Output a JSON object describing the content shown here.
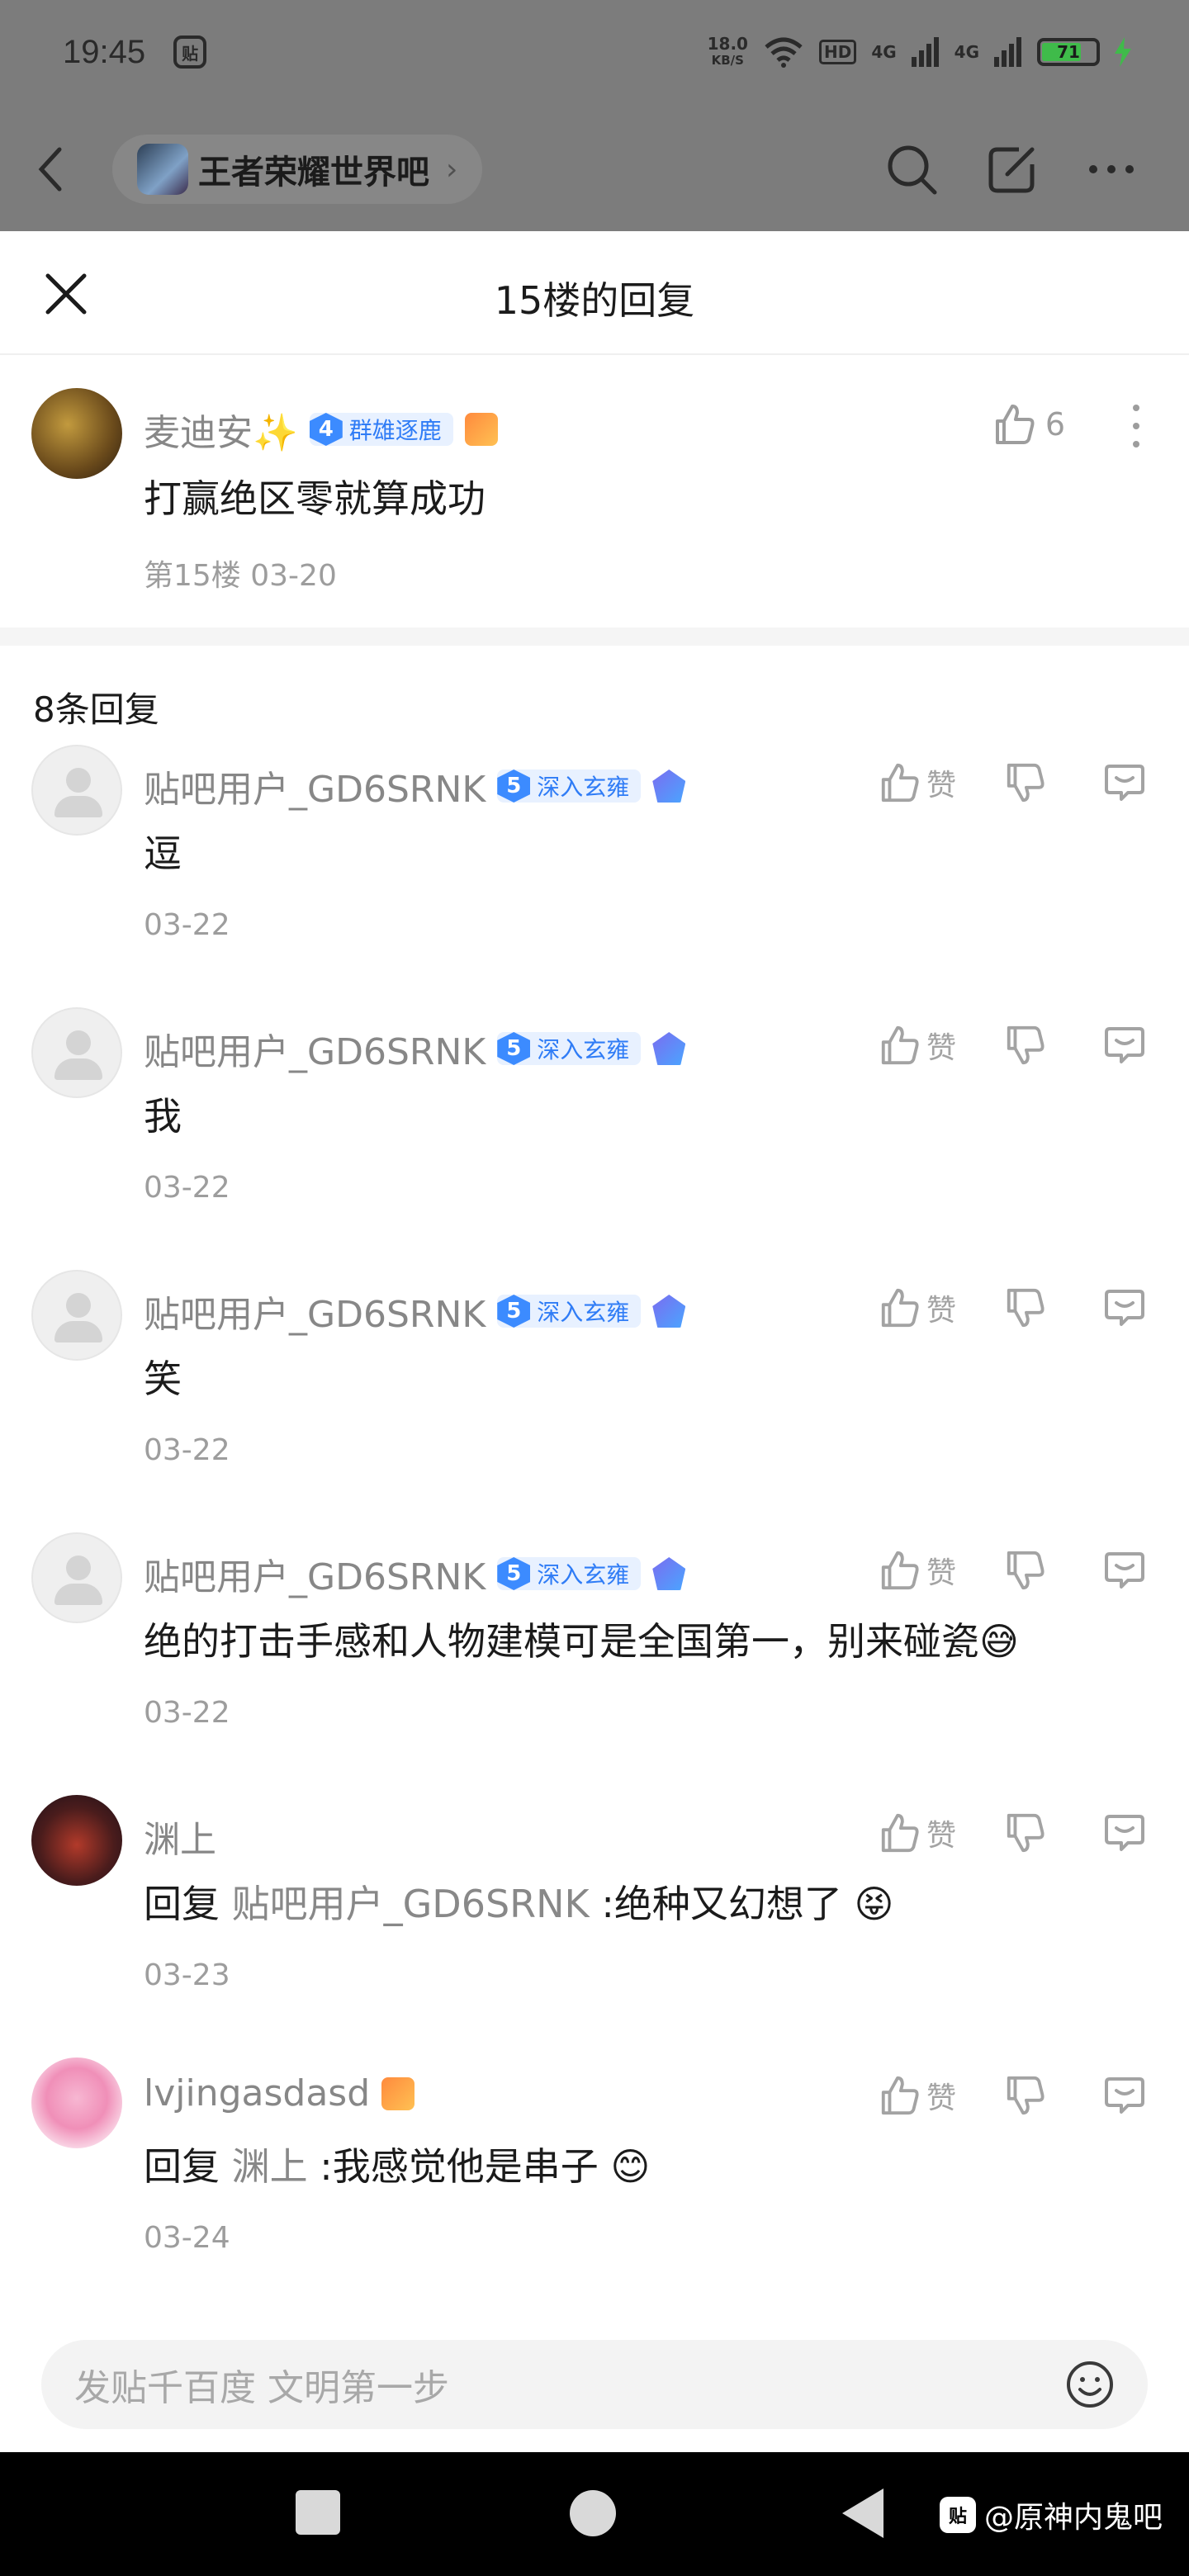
{
  "status_bar": {
    "time": "19:45",
    "app_icon": "贴",
    "net_speed_value": "18.0",
    "net_speed_unit": "KB/S",
    "hd_label": "HD",
    "signal_1": "4G",
    "signal_2": "4G",
    "battery": "71",
    "battery_level": 0.71
  },
  "topnav": {
    "forum_name": "王者荣耀世界吧"
  },
  "sheet": {
    "title": "15楼的回复",
    "main_post": {
      "username": "麦迪安✨",
      "badge_level": "4",
      "badge_text": "群雄逐鹿",
      "content": "打赢绝区零就算成功",
      "meta": "第15楼 03-20",
      "likes": "6"
    },
    "reply_count": "8条回复",
    "like_label": "赞",
    "replies": [
      {
        "username": "贴吧用户_GD6SRNK",
        "badge_level": "5",
        "badge_text": "深入玄雍",
        "content": "逗",
        "date": "03-22"
      },
      {
        "username": "贴吧用户_GD6SRNK",
        "badge_level": "5",
        "badge_text": "深入玄雍",
        "content": "我",
        "date": "03-22"
      },
      {
        "username": "贴吧用户_GD6SRNK",
        "badge_level": "5",
        "badge_text": "深入玄雍",
        "content": "笑",
        "date": "03-22"
      },
      {
        "username": "贴吧用户_GD6SRNK",
        "badge_level": "5",
        "badge_text": "深入玄雍",
        "content": "绝的打击手感和人物建模可是全国第一，别来碰瓷😅",
        "date": "03-22"
      },
      {
        "username": "渊上",
        "reply_prefix": "回复",
        "mention": "贴吧用户_GD6SRNK",
        "content": " :绝种又幻想了 😝",
        "date": "03-23"
      },
      {
        "username": "lvjingasdasd",
        "reply_prefix": "回复",
        "mention": "渊上",
        "content": " :我感觉他是串子 😊",
        "date": "03-24"
      }
    ]
  },
  "input": {
    "placeholder": "发贴千百度 文明第一步"
  },
  "watermark": {
    "icon": "贴",
    "text": "@原神内鬼吧"
  },
  "colors": {
    "badge_blue": "#3c8bff",
    "dim_overlay": "#7c7c7c",
    "battery_green": "#3fbb4a"
  }
}
